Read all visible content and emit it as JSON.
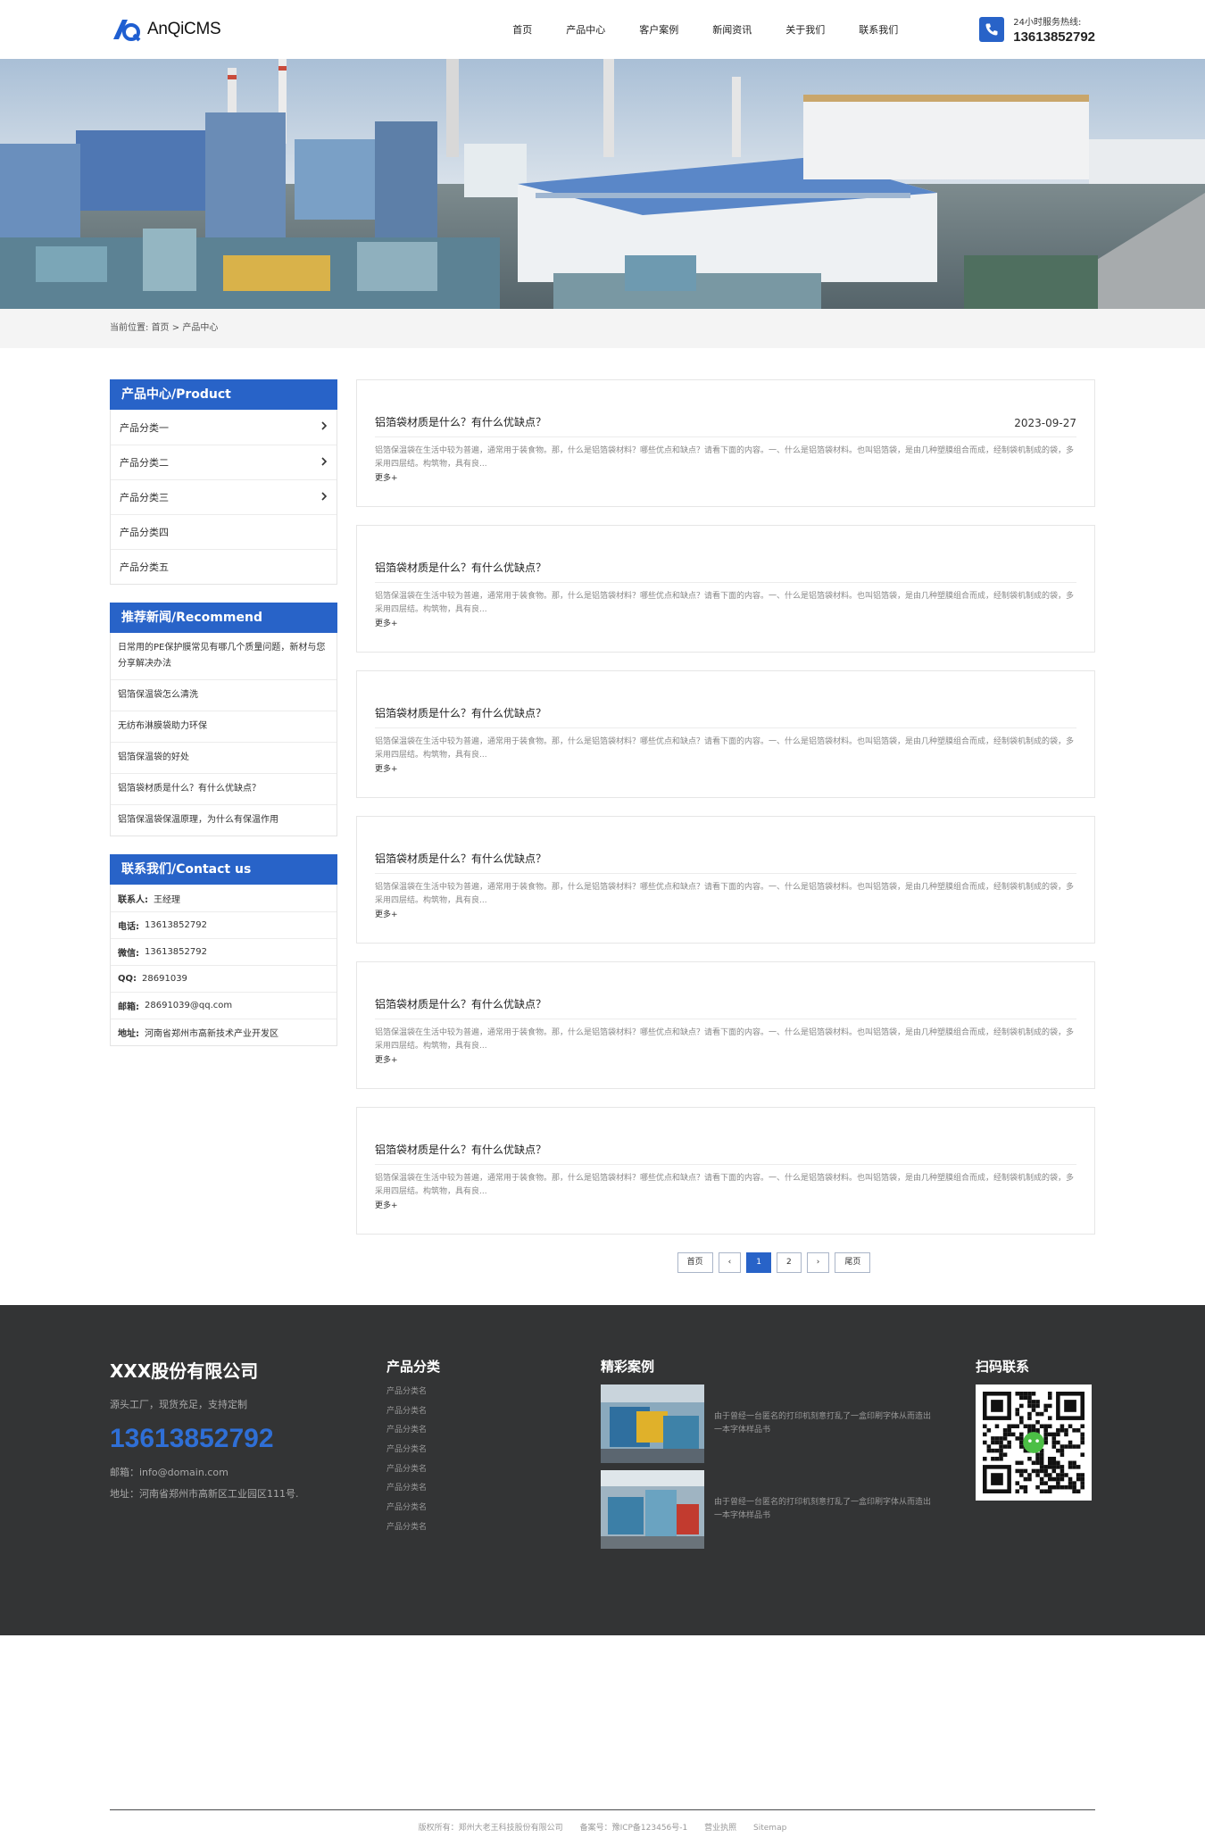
{
  "header": {
    "logo_text": "AnQiCMS",
    "nav": [
      "首页",
      "产品中心",
      "客户案例",
      "新闻资讯",
      "关于我们",
      "联系我们"
    ],
    "hotline_label": "24小时服务热线:",
    "hotline_number": "13613852792",
    "brand_color": "#2863c8"
  },
  "breadcrumb": {
    "label": "当前位置:",
    "home": "首页",
    "sep": ">",
    "current": "产品中心"
  },
  "sidebar": {
    "product_title": "产品中心/Product",
    "categories": [
      {
        "label": "产品分类一",
        "has_children": true
      },
      {
        "label": "产品分类二",
        "has_children": true
      },
      {
        "label": "产品分类三",
        "has_children": true
      },
      {
        "label": "产品分类四",
        "has_children": false
      },
      {
        "label": "产品分类五",
        "has_children": false
      }
    ],
    "recommend_title": "推荐新闻/Recommend",
    "recommend": [
      "日常用的PE保护膜常见有哪几个质量问题，新材与您分享解决办法",
      "铝箔保温袋怎么清洗",
      "无纺布淋膜袋助力环保",
      "铝箔保温袋的好处",
      "铝箔袋材质是什么？有什么优缺点？",
      "铝箔保温袋保温原理，为什么有保温作用"
    ],
    "contact_title": "联系我们/Contact us",
    "contact": [
      {
        "k": "联系人:",
        "v": "王经理"
      },
      {
        "k": "电话:",
        "v": "13613852792"
      },
      {
        "k": "微信:",
        "v": "13613852792"
      },
      {
        "k": "QQ:",
        "v": "28691039"
      },
      {
        "k": "邮箱:",
        "v": "28691039@qq.com"
      },
      {
        "k": "地址:",
        "v": "河南省郑州市高新技术产业开发区"
      }
    ]
  },
  "articles": [
    {
      "title": "铝箔袋材质是什么？有什么优缺点？",
      "date": "2023-09-27",
      "summary": "铝箔保温袋在生活中较为普遍，通常用于装食物。那，什么是铝箔袋材料？哪些优点和缺点？请看下面的内容。一、什么是铝箔袋材料。也叫铝箔袋，是由几种塑膜组合而成，经制袋机制成的袋，多采用四层结。构筑物，具有良...",
      "more": "更多+"
    },
    {
      "title": "铝箔袋材质是什么？有什么优缺点？",
      "date": "",
      "summary": "铝箔保温袋在生活中较为普遍，通常用于装食物。那，什么是铝箔袋材料？哪些优点和缺点？请看下面的内容。一、什么是铝箔袋材料。也叫铝箔袋，是由几种塑膜组合而成，经制袋机制成的袋，多采用四层结。构筑物，具有良...",
      "more": "更多+"
    },
    {
      "title": "铝箔袋材质是什么？有什么优缺点？",
      "date": "",
      "summary": "铝箔保温袋在生活中较为普遍，通常用于装食物。那，什么是铝箔袋材料？哪些优点和缺点？请看下面的内容。一、什么是铝箔袋材料。也叫铝箔袋，是由几种塑膜组合而成，经制袋机制成的袋，多采用四层结。构筑物，具有良...",
      "more": "更多+"
    },
    {
      "title": "铝箔袋材质是什么？有什么优缺点？",
      "date": "",
      "summary": "铝箔保温袋在生活中较为普遍，通常用于装食物。那，什么是铝箔袋材料？哪些优点和缺点？请看下面的内容。一、什么是铝箔袋材料。也叫铝箔袋，是由几种塑膜组合而成，经制袋机制成的袋，多采用四层结。构筑物，具有良...",
      "more": "更多+"
    },
    {
      "title": "铝箔袋材质是什么？有什么优缺点？",
      "date": "",
      "summary": "铝箔保温袋在生活中较为普遍，通常用于装食物。那，什么是铝箔袋材料？哪些优点和缺点？请看下面的内容。一、什么是铝箔袋材料。也叫铝箔袋，是由几种塑膜组合而成，经制袋机制成的袋，多采用四层结。构筑物，具有良...",
      "more": "更多+"
    },
    {
      "title": "铝箔袋材质是什么？有什么优缺点？",
      "date": "",
      "summary": "铝箔保温袋在生活中较为普遍，通常用于装食物。那，什么是铝箔袋材料？哪些优点和缺点？请看下面的内容。一、什么是铝箔袋材料。也叫铝箔袋，是由几种塑膜组合而成，经制袋机制成的袋，多采用四层结。构筑物，具有良...",
      "more": "更多+"
    }
  ],
  "pager": {
    "first": "首页",
    "prev": "‹",
    "pages": [
      "1",
      "2"
    ],
    "current": "1",
    "next": "›",
    "last": "尾页"
  },
  "footer": {
    "company": "XXX股份有限公司",
    "slogan": "源头工厂，现货充足，支持定制",
    "phone": "13613852792",
    "email": "邮箱：info@domain.com",
    "address": "地址：河南省郑州市高新区工业园区111号.",
    "cat_title": "产品分类",
    "cats": [
      "产品分类名",
      "产品分类名",
      "产品分类名",
      "产品分类名",
      "产品分类名",
      "产品分类名",
      "产品分类名",
      "产品分类名"
    ],
    "case_title": "精彩案例",
    "cases": [
      "由于曾经一台匿名的打印机刻意打乱了一盒印刷字体从而造出一本字体样品书",
      "由于曾经一台匿名的打印机刻意打乱了一盒印刷字体从而造出一本字体样品书"
    ],
    "qr_title": "扫码联系",
    "copyright": "版权所有：郑州大老王科技股份有限公司",
    "icp": "备案号：豫ICP备123456号-1",
    "license": "营业执照",
    "sitemap": "Sitemap"
  }
}
